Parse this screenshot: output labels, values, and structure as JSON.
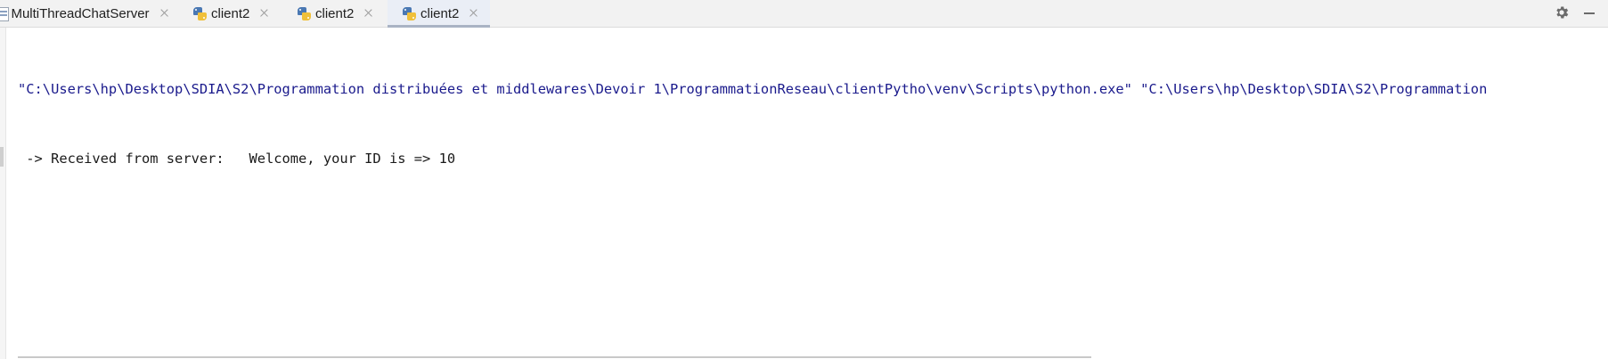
{
  "tabs": [
    {
      "label": "MultiThreadChatServer",
      "icon": "java-class-icon",
      "active": false
    },
    {
      "label": "client2",
      "icon": "python-icon",
      "active": false
    },
    {
      "label": "client2",
      "icon": "python-icon",
      "active": false
    },
    {
      "label": "client2",
      "icon": "python-icon",
      "active": true
    }
  ],
  "toolbar": {
    "settings_icon": "gear-icon",
    "minimize_icon": "minimize-icon"
  },
  "console": {
    "command_line": "\"C:\\Users\\hp\\Desktop\\SDIA\\S2\\Programmation distribuées et middlewares\\Devoir 1\\ProgrammationReseau\\clientPytho\\venv\\Scripts\\python.exe\" \"C:\\Users\\hp\\Desktop\\SDIA\\S2\\Programmation",
    "output_line": " -> Received from server:   Welcome, your ID is => 10"
  },
  "colors": {
    "command_text": "#1a1a8c",
    "output_text": "#1a1a1a",
    "active_tab_underline": "#a9b3c4"
  }
}
